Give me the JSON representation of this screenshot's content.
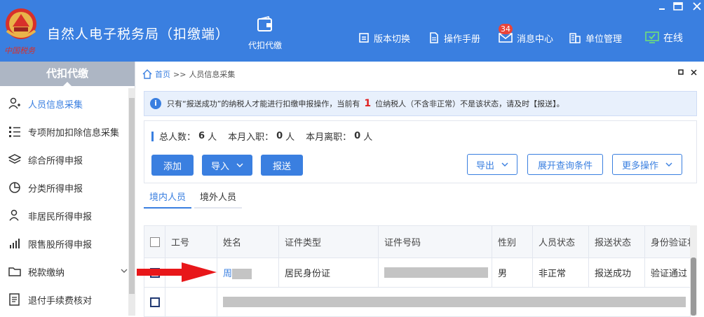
{
  "app": {
    "title": "自然人电子税务局（扣缴端）",
    "module_label": "代扣代缴",
    "emblem_text": "中国税务",
    "nav": {
      "version_switch": "版本切换",
      "manual": "操作手册",
      "messages": "消息中心",
      "messages_count": "34",
      "unit_mgmt": "单位管理",
      "online": "在线"
    }
  },
  "sidebar": {
    "title": "代扣代缴",
    "items": [
      {
        "label": "人员信息采集",
        "icon": "person-add-icon",
        "active": true
      },
      {
        "label": "专项附加扣除信息采集",
        "icon": "list-icon",
        "active": false
      },
      {
        "label": "综合所得申报",
        "icon": "layers-icon",
        "active": false
      },
      {
        "label": "分类所得申报",
        "icon": "pie-chart-icon",
        "active": false
      },
      {
        "label": "非居民所得申报",
        "icon": "person-icon",
        "active": false
      },
      {
        "label": "限售股所得申报",
        "icon": "bar-chart-icon",
        "active": false
      },
      {
        "label": "税款缴纳",
        "icon": "folder-icon",
        "active": false
      },
      {
        "label": "退付手续费核对",
        "icon": "document-icon",
        "active": false
      }
    ]
  },
  "breadcrumb": {
    "home": "首页",
    "sep": ">>",
    "current": "人员信息采集"
  },
  "notice": {
    "prefix": "只有“报送成功”的纳税人才能进行扣缴申报操作，当前有",
    "count": "1",
    "suffix": "位纳税人（不含非正常）不是该状态，请及时【报送】。"
  },
  "stats": {
    "total_label": "总人数：",
    "total_value": "6",
    "total_unit": "人",
    "hired_label": "本月入职：",
    "hired_value": "0",
    "hired_unit": "人",
    "left_label": "本月离职：",
    "left_value": "0",
    "left_unit": "人"
  },
  "actions": {
    "add": "添加",
    "import": "导入",
    "submit": "报送",
    "export": "导出",
    "expand_query": "展开查询条件",
    "more": "更多操作"
  },
  "tabs": [
    "境内人员",
    "境外人员"
  ],
  "table": {
    "headers": [
      "工号",
      "姓名",
      "证件类型",
      "证件号码",
      "性别",
      "人员状态",
      "报送状态",
      "身份验证状态"
    ],
    "rows": [
      {
        "id": "",
        "name": "周",
        "id_type": "居民身份证",
        "id_number": "",
        "gender": "男",
        "status": "非正常",
        "report": "报送成功",
        "verify": "验证通过"
      }
    ]
  },
  "colors": {
    "accent": "#3a7fe0",
    "header_bg": "#3a7fe0",
    "arrow": "#e8171a",
    "alert": "#e02020"
  }
}
